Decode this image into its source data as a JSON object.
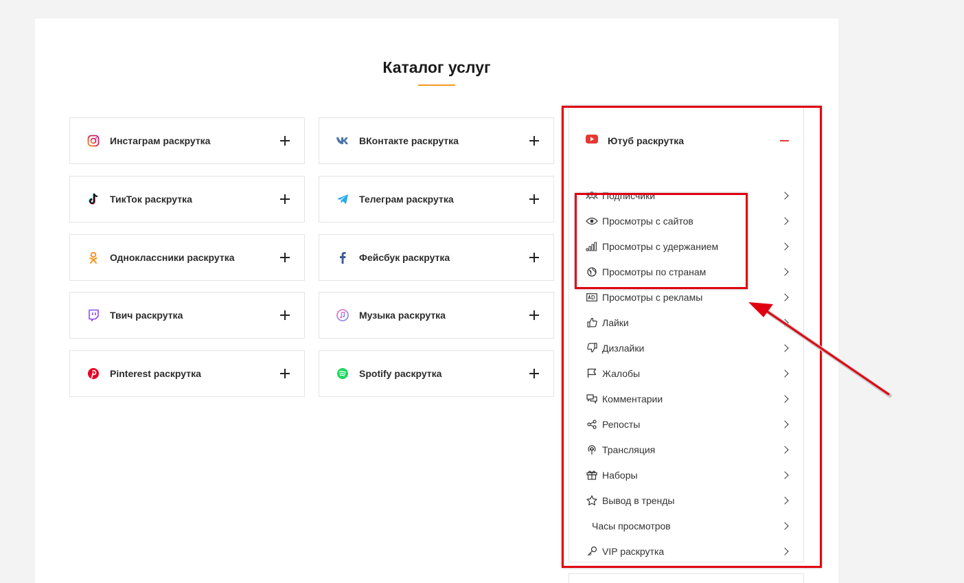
{
  "page": {
    "title": "Каталог услуг"
  },
  "catalog": {
    "col1": [
      {
        "label": "Инстаграм раскрутка",
        "icon": "instagram-icon"
      },
      {
        "label": "ТикТок раскрутка",
        "icon": "tiktok-icon"
      },
      {
        "label": "Одноклассники раскрутка",
        "icon": "odnoklassniki-icon"
      },
      {
        "label": "Твич раскрутка",
        "icon": "twitch-icon"
      },
      {
        "label": "Pinterest раскрутка",
        "icon": "pinterest-icon"
      }
    ],
    "col2": [
      {
        "label": "ВКонтакте раскрутка",
        "icon": "vk-icon"
      },
      {
        "label": "Телеграм раскрутка",
        "icon": "telegram-icon"
      },
      {
        "label": "Фейсбук раскрутка",
        "icon": "facebook-icon"
      },
      {
        "label": "Музыка раскрутка",
        "icon": "music-icon"
      },
      {
        "label": "Spotify раскрутка",
        "icon": "spotify-icon"
      }
    ]
  },
  "youtube": {
    "label": "Ютуб раскрутка",
    "icon": "youtube-icon",
    "items": [
      {
        "label": "Подписчики",
        "icon": "users-icon"
      },
      {
        "label": "Просмотры с сайтов",
        "icon": "eye-icon"
      },
      {
        "label": "Просмотры с удержанием",
        "icon": "signal-bars-icon"
      },
      {
        "label": "Просмотры по странам",
        "icon": "globe-icon"
      },
      {
        "label": "Просмотры с рекламы",
        "icon": "ad-icon"
      },
      {
        "label": "Лайки",
        "icon": "thumbs-up-icon"
      },
      {
        "label": "Дизлайки",
        "icon": "thumbs-down-icon"
      },
      {
        "label": "Жалобы",
        "icon": "flag-icon"
      },
      {
        "label": "Комментарии",
        "icon": "comments-icon"
      },
      {
        "label": "Репосты",
        "icon": "share-icon"
      },
      {
        "label": "Трансляция",
        "icon": "broadcast-icon"
      },
      {
        "label": "Наборы",
        "icon": "gift-icon"
      },
      {
        "label": "Вывод в тренды",
        "icon": "star-icon"
      },
      {
        "label": "Часы просмотров",
        "icon": ""
      },
      {
        "label": "VIP раскрутка",
        "icon": "key-icon"
      }
    ]
  },
  "colors": {
    "accent": "#f39a1e",
    "annotation": "#e00010",
    "youtube": "#e53935"
  }
}
